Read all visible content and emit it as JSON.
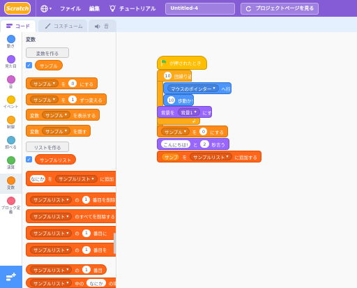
{
  "menubar": {
    "logo": "Scratch",
    "file": "ファイル",
    "edit": "編集",
    "tutorial": "チュートリアル",
    "project_title": "Untitled-4",
    "project_page": "プロジェクトページを見る"
  },
  "tabs": {
    "code": "コード",
    "costume": "コスチューム",
    "sound": "音"
  },
  "categories": [
    {
      "label": "動き",
      "color": "#4c97ff"
    },
    {
      "label": "見た目",
      "color": "#9966ff"
    },
    {
      "label": "音",
      "color": "#cf63cf"
    },
    {
      "label": "イベント",
      "color": "#ffbf00"
    },
    {
      "label": "制御",
      "color": "#ffab19"
    },
    {
      "label": "調べる",
      "color": "#5cb1d6"
    },
    {
      "label": "演算",
      "color": "#59c059"
    },
    {
      "label": "変数",
      "color": "#ff8c1a"
    },
    {
      "label": "ブロック定義",
      "color": "#ff6680"
    }
  ],
  "palette": {
    "section_title": "変数",
    "make_variable": "変数を作る",
    "variable_name": "サンプル",
    "set_label": "を",
    "set_value": "0",
    "set_suffix": "にする",
    "change_label": "を",
    "change_value": "1",
    "change_suffix": "ずつ変える",
    "show_prefix": "変数",
    "show_suffix": "を表示する",
    "hide_prefix": "変数",
    "hide_suffix": "を隠す",
    "make_list": "リストを作る",
    "list_name": "サンプルリスト",
    "add_value": "なにか",
    "add_suffix": "に追加",
    "delete_of": "の",
    "delete_index": "1",
    "delete_suffix": "番目を削除",
    "delete_all_of": "のすべてを削除する",
    "insert_of": "の",
    "insert_index": "1",
    "insert_suffix": "番目に",
    "replace_of": "の",
    "replace_index": "1",
    "replace_suffix": "番目を",
    "item_of": "の",
    "item_index": "1",
    "item_suffix": "番目",
    "itemnum_of": "中の",
    "itemnum_value": "なにか",
    "itemnum_suffix": "の場所"
  },
  "script": {
    "hat": "が押されたとき",
    "repeat_value": "10",
    "repeat_suffix": "回繰り返す",
    "goto_target": "マウスのポインター",
    "goto_suffix": "へ行く",
    "move_value": "10",
    "move_suffix": "歩動かす",
    "backdrop_prefix": "背景を",
    "backdrop_value": "背景1",
    "backdrop_suffix": "にする",
    "set_var": "サンプル",
    "set_label": "を",
    "set_value": "0",
    "set_suffix": "にする",
    "say_value": "こんにちは!",
    "say_mid": "と",
    "say_secs": "2",
    "say_suffix": "秒言う",
    "add_var": "サンプル",
    "add_mid": "を",
    "add_list": "サンプルリスト",
    "add_suffix": "に追加する"
  }
}
